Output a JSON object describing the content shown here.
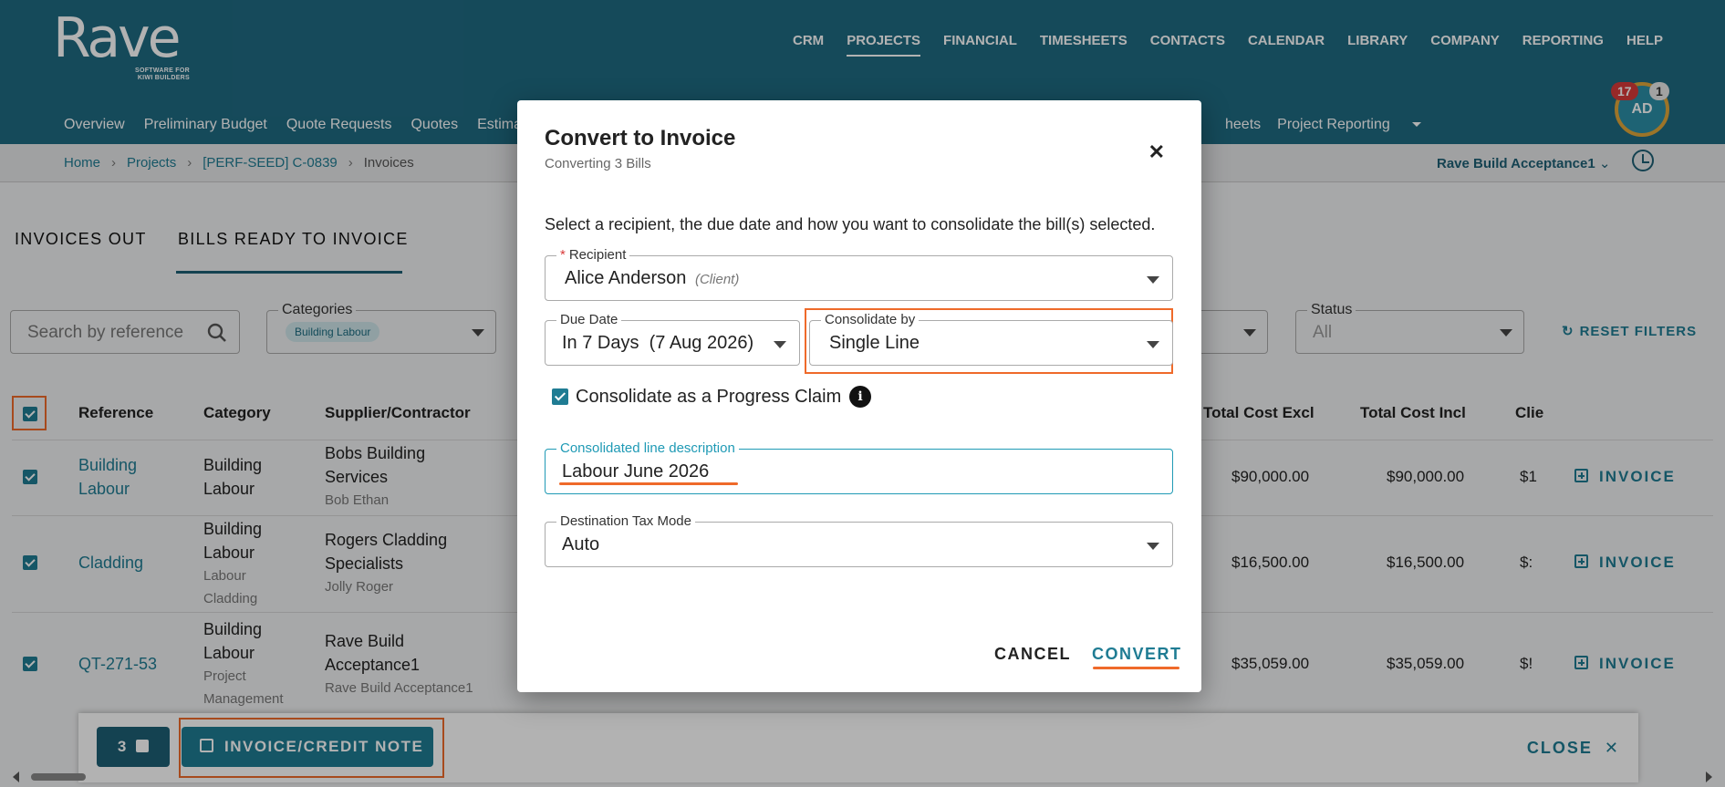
{
  "brand": {
    "name": "Rave",
    "tagline_1": "SOFTWARE FOR",
    "tagline_2": "KIWI BUILDERS"
  },
  "main_nav": [
    "CRM",
    "PROJECTS",
    "FINANCIAL",
    "TIMESHEETS",
    "CONTACTS",
    "CALENDAR",
    "LIBRARY",
    "COMPANY",
    "REPORTING",
    "HELP"
  ],
  "sub_nav": [
    "Overview",
    "Preliminary Budget",
    "Quote Requests",
    "Quotes",
    "Estimate"
  ],
  "sub_nav_right": {
    "partial": "heets",
    "reporting": "Project Reporting"
  },
  "user": {
    "initials": "AD",
    "notifications": "17",
    "messages": "1"
  },
  "breadcrumb": {
    "home": "Home",
    "projects": "Projects",
    "project": "[PERF-SEED] C-0839",
    "current": "Invoices"
  },
  "project_selector": "Rave Build Acceptance1",
  "tabs": {
    "invoices_out": "INVOICES OUT",
    "bills_ready": "BILLS READY TO INVOICE"
  },
  "filters": {
    "search_placeholder": "Search by reference",
    "categories_label": "Categories",
    "categories_chip": "Building Labour",
    "status_label": "Status",
    "status_value": "All",
    "reset": "RESET FILTERS"
  },
  "table": {
    "headers": {
      "reference": "Reference",
      "category": "Category",
      "supplier": "Supplier/Contractor",
      "total_excl": "Total Cost Excl",
      "total_incl": "Total Cost Incl",
      "client": "Clie"
    },
    "rows": [
      {
        "ref": "Building Labour",
        "ref_l1": "Building",
        "ref_l2": "Labour",
        "cat_l1": "Building",
        "cat_l2": "Labour",
        "sup_l1": "Bobs Building",
        "sup_l2": "Services",
        "sup_contact": "Bob Ethan",
        "excl": "$90,000.00",
        "incl": "$90,000.00",
        "client": "$1"
      },
      {
        "ref": "Cladding",
        "cat_l1": "Building",
        "cat_l2": "Labour",
        "cat_sub1": "Labour",
        "cat_sub2": "Cladding",
        "sup_l1": "Rogers Cladding",
        "sup_l2": "Specialists",
        "sup_contact": "Jolly Roger",
        "excl": "$16,500.00",
        "incl": "$16,500.00",
        "client": "$:"
      },
      {
        "ref": "QT-271-53",
        "cat_l1": "Building",
        "cat_l2": "Labour",
        "cat_sub1": "Project",
        "cat_sub2": "Management",
        "sup_l1": "Rave Build",
        "sup_l2": "Acceptance1",
        "sup_contact": "Rave Build Acceptance1",
        "excl": "$35,059.00",
        "incl": "$35,059.00",
        "client": "$!"
      }
    ],
    "row_action": "INVOICE"
  },
  "bottom_bar": {
    "count": "3",
    "invoice_credit": "INVOICE/CREDIT NOTE",
    "close": "CLOSE"
  },
  "modal": {
    "title": "Convert to Invoice",
    "subtitle": "Converting 3 Bills",
    "description": "Select a recipient, the due date and how you want to consolidate the bill(s) selected.",
    "recipient_label": "Recipient",
    "recipient_value": "Alice Anderson",
    "recipient_hint": "(Client)",
    "due_date_label": "Due Date",
    "due_date_value": "In 7 Days  (7 Aug 2026)",
    "consolidate_label": "Consolidate by",
    "consolidate_value": "Single Line",
    "progress_claim_label": "Consolidate as a Progress Claim",
    "progress_claim_checked": true,
    "line_desc_label": "Consolidated line description",
    "line_desc_value": "Labour June 2026",
    "tax_mode_label": "Destination Tax Mode",
    "tax_mode_value": "Auto",
    "cancel": "CANCEL",
    "convert": "CONVERT"
  },
  "colors": {
    "header": "#1f6a82",
    "accent": "#1f7c93",
    "highlight": "#ef6a2a"
  }
}
